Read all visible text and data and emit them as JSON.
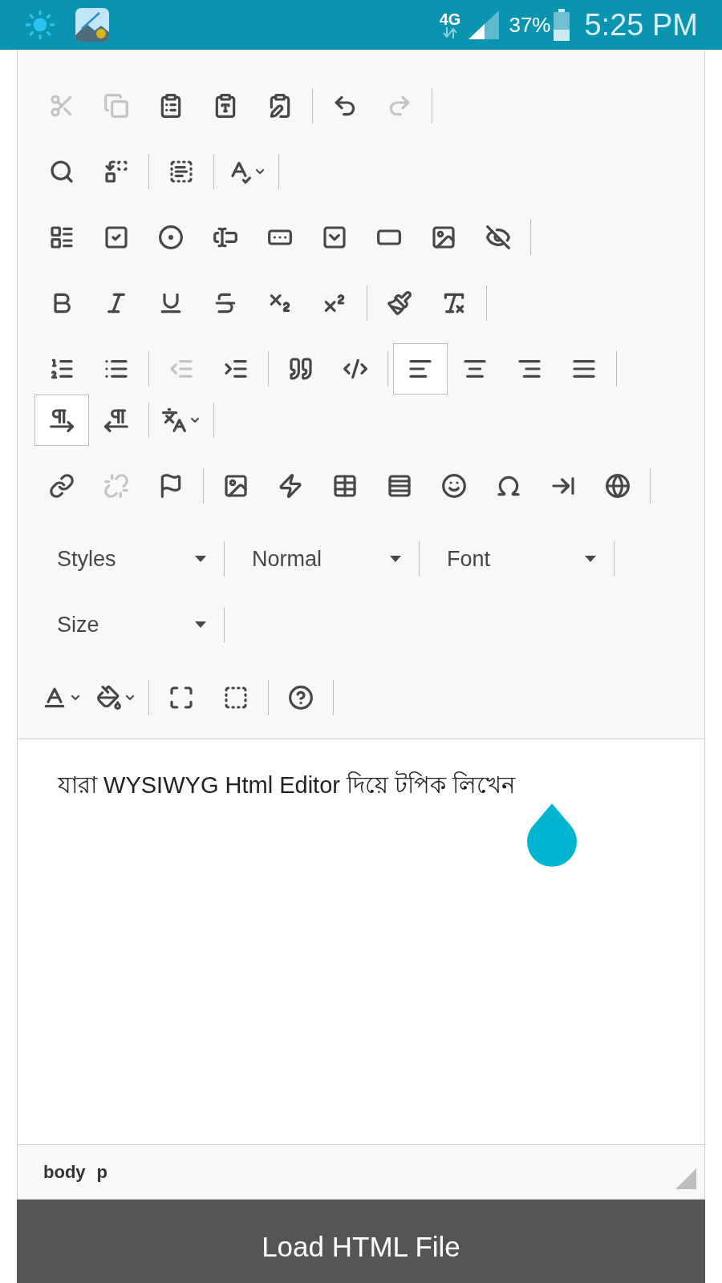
{
  "status_bar": {
    "network": "4G",
    "battery": "37%",
    "time": "5:25 PM"
  },
  "toolbar": {
    "rows": [
      {
        "groups": [
          [
            {
              "kind": "cut",
              "disabled": true,
              "selected": false
            },
            {
              "kind": "copy",
              "disabled": true,
              "selected": false
            },
            {
              "kind": "paste",
              "disabled": false,
              "selected": false
            },
            {
              "kind": "paste-text",
              "disabled": false,
              "selected": false
            },
            {
              "kind": "paste-word",
              "disabled": false,
              "selected": false
            }
          ],
          [
            {
              "kind": "undo",
              "disabled": false,
              "selected": false
            },
            {
              "kind": "redo",
              "disabled": true,
              "selected": false
            }
          ]
        ]
      },
      {
        "groups": [
          [
            {
              "kind": "find",
              "disabled": false,
              "selected": false
            },
            {
              "kind": "replace",
              "disabled": false,
              "selected": false
            }
          ],
          [
            {
              "kind": "select-all",
              "disabled": false,
              "selected": false
            }
          ],
          [
            {
              "kind": "spellcheck",
              "disabled": false,
              "selected": false
            }
          ]
        ]
      },
      {
        "groups": [
          [
            {
              "kind": "form",
              "disabled": false,
              "selected": false
            },
            {
              "kind": "checkbox",
              "disabled": false,
              "selected": false
            },
            {
              "kind": "radio",
              "disabled": false,
              "selected": false
            },
            {
              "kind": "text-field",
              "disabled": false,
              "selected": false
            },
            {
              "kind": "textarea",
              "disabled": false,
              "selected": false
            },
            {
              "kind": "select",
              "disabled": false,
              "selected": false
            },
            {
              "kind": "button",
              "disabled": false,
              "selected": false
            },
            {
              "kind": "image-button",
              "disabled": false,
              "selected": false
            },
            {
              "kind": "hidden-field",
              "disabled": false,
              "selected": false
            }
          ]
        ]
      },
      {
        "groups": [
          [
            {
              "kind": "bold",
              "disabled": false,
              "selected": false
            },
            {
              "kind": "italic",
              "disabled": false,
              "selected": false
            },
            {
              "kind": "underline",
              "disabled": false,
              "selected": false
            },
            {
              "kind": "strike",
              "disabled": false,
              "selected": false
            },
            {
              "kind": "subscript",
              "disabled": false,
              "selected": false
            },
            {
              "kind": "superscript",
              "disabled": false,
              "selected": false
            }
          ],
          [
            {
              "kind": "copy-format",
              "disabled": false,
              "selected": false
            },
            {
              "kind": "remove-format",
              "disabled": false,
              "selected": false
            }
          ]
        ]
      },
      {
        "groups": [
          [
            {
              "kind": "numbered-list",
              "disabled": false,
              "selected": false
            },
            {
              "kind": "bulleted-list",
              "disabled": false,
              "selected": false
            }
          ],
          [
            {
              "kind": "outdent",
              "disabled": true,
              "selected": false
            },
            {
              "kind": "indent",
              "disabled": false,
              "selected": false
            }
          ],
          [
            {
              "kind": "blockquote",
              "disabled": false,
              "selected": false
            },
            {
              "kind": "div",
              "disabled": false,
              "selected": false
            }
          ],
          [
            {
              "kind": "align-left",
              "disabled": false,
              "selected": true
            },
            {
              "kind": "align-center",
              "disabled": false,
              "selected": false
            },
            {
              "kind": "align-right",
              "disabled": false,
              "selected": false
            },
            {
              "kind": "justify",
              "disabled": false,
              "selected": false
            }
          ],
          [
            {
              "kind": "ltr",
              "disabled": false,
              "selected": true
            },
            {
              "kind": "rtl",
              "disabled": false,
              "selected": false
            }
          ],
          [
            {
              "kind": "language",
              "disabled": false,
              "selected": false
            }
          ]
        ]
      },
      {
        "groups": [
          [
            {
              "kind": "link",
              "disabled": false,
              "selected": false
            },
            {
              "kind": "unlink",
              "disabled": true,
              "selected": false
            },
            {
              "kind": "anchor",
              "disabled": false,
              "selected": false
            }
          ],
          [
            {
              "kind": "image",
              "disabled": false,
              "selected": false
            },
            {
              "kind": "flash",
              "disabled": false,
              "selected": false
            },
            {
              "kind": "table",
              "disabled": false,
              "selected": false
            },
            {
              "kind": "horizontal-rule",
              "disabled": false,
              "selected": false
            },
            {
              "kind": "smiley",
              "disabled": false,
              "selected": false
            },
            {
              "kind": "special-char",
              "disabled": false,
              "selected": false
            },
            {
              "kind": "page-break",
              "disabled": false,
              "selected": false
            },
            {
              "kind": "iframe",
              "disabled": false,
              "selected": false
            }
          ]
        ]
      }
    ],
    "combos": [
      {
        "label": "Styles"
      },
      {
        "label": "Normal"
      },
      {
        "label": "Font"
      },
      {
        "label": "Size"
      }
    ],
    "last_row": {
      "groups": [
        [
          {
            "kind": "text-color",
            "disabled": false,
            "selected": false
          },
          {
            "kind": "bg-color",
            "disabled": false,
            "selected": false
          }
        ],
        [
          {
            "kind": "maximize",
            "disabled": false,
            "selected": false
          },
          {
            "kind": "show-blocks",
            "disabled": false,
            "selected": false
          }
        ],
        [
          {
            "kind": "about",
            "disabled": false,
            "selected": false
          }
        ]
      ]
    }
  },
  "content": {
    "text": "যারা WYSIWYG Html Editor দিয়ে টপিক লিখেন"
  },
  "path_bar": [
    "body",
    "p"
  ],
  "load_button": {
    "label": "Load HTML File"
  }
}
